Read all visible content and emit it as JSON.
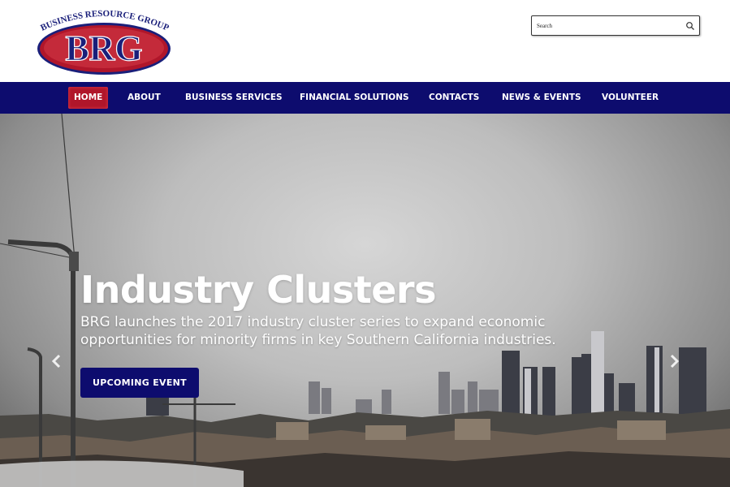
{
  "logo": {
    "tagline": "BUSINESS RESOURCE GROUP",
    "mark": "BRG"
  },
  "search": {
    "placeholder": "Search",
    "icon": "search-icon"
  },
  "nav": {
    "items": [
      {
        "label": "HOME",
        "active": true
      },
      {
        "label": "ABOUT"
      },
      {
        "label": "BUSINESS SERVICES"
      },
      {
        "label": "FINANCIAL SOLUTIONS"
      },
      {
        "label": "CONTACTS"
      },
      {
        "label": "NEWS & EVENTS"
      },
      {
        "label": "VOLUNTEER"
      }
    ]
  },
  "hero": {
    "title": "Industry Clusters",
    "subtitle": "BRG launches the 2017 industry cluster series to expand economic opportunities for minority firms in key Southern California industries.",
    "button_label": "UPCOMING EVENT",
    "prev_icon": "chevron-left-icon",
    "next_icon": "chevron-right-icon"
  },
  "colors": {
    "nav_bg": "#0d0c6e",
    "active_bg": "#b0162a",
    "logo_red": "#b0162a",
    "logo_blue": "#1a1f7a"
  }
}
